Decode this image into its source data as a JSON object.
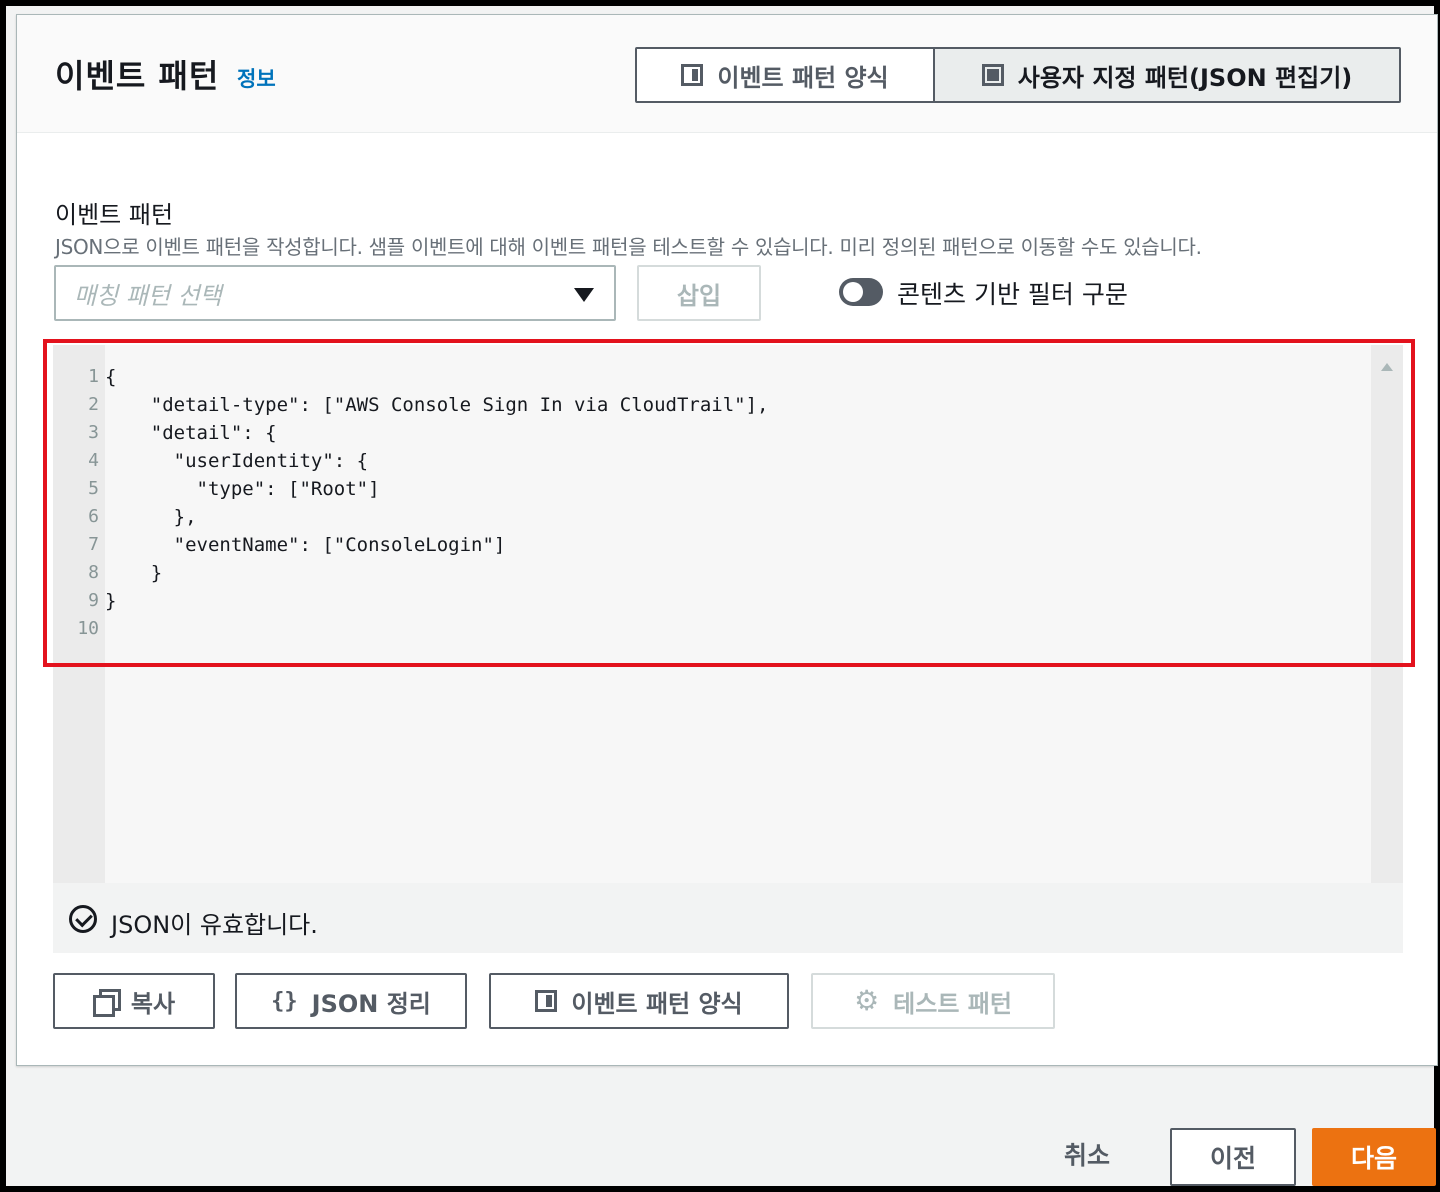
{
  "header": {
    "title": "이벤트 패턴",
    "info_link": "정보",
    "segments": [
      {
        "label": "이벤트 패턴 양식",
        "icon": "half-panel-icon",
        "selected": false
      },
      {
        "label": "사용자 지정 패턴(JSON 편집기)",
        "icon": "full-panel-icon",
        "selected": true
      }
    ]
  },
  "field": {
    "label": "이벤트 패턴",
    "description": "JSON으로 이벤트 패턴을 작성합니다. 샘플 이벤트에 대해 이벤트 패턴을 테스트할 수 있습니다. 미리 정의된 패턴으로 이동할 수도 있습니다."
  },
  "controls": {
    "select_placeholder": "매칭 패턴 선택",
    "insert_label": "삽입",
    "toggle_label": "콘텐츠 기반 필터 구문"
  },
  "editor": {
    "lines": [
      {
        "n": "1",
        "text": "{"
      },
      {
        "n": "2",
        "text": "    \"detail-type\": [\"AWS Console Sign In via CloudTrail\"],"
      },
      {
        "n": "3",
        "text": "    \"detail\": {"
      },
      {
        "n": "4",
        "text": "      \"userIdentity\": {"
      },
      {
        "n": "5",
        "text": "        \"type\": [\"Root\"]"
      },
      {
        "n": "6",
        "text": "      },"
      },
      {
        "n": "7",
        "text": "      \"eventName\": [\"ConsoleLogin\"]"
      },
      {
        "n": "8",
        "text": "    }"
      },
      {
        "n": "9",
        "text": "}"
      },
      {
        "n": "10",
        "text": ""
      }
    ],
    "status": "JSON이 유효합니다."
  },
  "actions": {
    "copy": "복사",
    "format_json": "JSON 정리",
    "pattern_form": "이벤트 패턴 양식",
    "test_pattern": "테스트 패턴"
  },
  "footer": {
    "cancel": "취소",
    "previous": "이전",
    "next": "다음"
  },
  "colors": {
    "primary": "#ec7211",
    "link": "#0073bb",
    "highlight": "#e3121d"
  }
}
